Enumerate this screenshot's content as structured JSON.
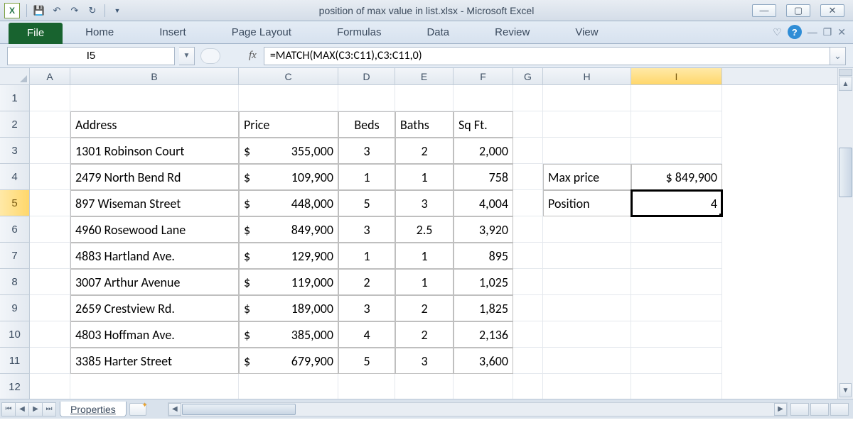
{
  "window": {
    "title": "position of max value in list.xlsx  -  Microsoft Excel"
  },
  "qat": {
    "save": "save",
    "undo": "undo",
    "redo": "redo",
    "repeat": "repeat"
  },
  "ribbon": {
    "file": "File",
    "tabs": [
      "Home",
      "Insert",
      "Page Layout",
      "Formulas",
      "Data",
      "Review",
      "View"
    ]
  },
  "formula_bar": {
    "namebox": "I5",
    "fx": "fx",
    "formula": "=MATCH(MAX(C3:C11),C3:C11,0)"
  },
  "columns": [
    "A",
    "B",
    "C",
    "D",
    "E",
    "F",
    "G",
    "H",
    "I"
  ],
  "rows": [
    "1",
    "2",
    "3",
    "4",
    "5",
    "6",
    "7",
    "8",
    "9",
    "10",
    "11",
    "12"
  ],
  "active": {
    "col": "I",
    "row": "5"
  },
  "table": {
    "headers": {
      "address": "Address",
      "price": "Price",
      "beds": "Beds",
      "baths": "Baths",
      "sqft": "Sq Ft."
    },
    "rows": [
      {
        "address": "1301 Robinson Court",
        "price": "355,000",
        "beds": "3",
        "baths": "2",
        "sqft": "2,000"
      },
      {
        "address": "2479 North Bend Rd",
        "price": "109,900",
        "beds": "1",
        "baths": "1",
        "sqft": "758"
      },
      {
        "address": "897 Wiseman Street",
        "price": "448,000",
        "beds": "5",
        "baths": "3",
        "sqft": "4,004"
      },
      {
        "address": "4960 Rosewood Lane",
        "price": "849,900",
        "beds": "3",
        "baths": "2.5",
        "sqft": "3,920"
      },
      {
        "address": "4883 Hartland Ave.",
        "price": "129,900",
        "beds": "1",
        "baths": "1",
        "sqft": "895"
      },
      {
        "address": "3007 Arthur Avenue",
        "price": "119,000",
        "beds": "2",
        "baths": "1",
        "sqft": "1,025"
      },
      {
        "address": "2659 Crestview Rd.",
        "price": "189,000",
        "beds": "3",
        "baths": "2",
        "sqft": "1,825"
      },
      {
        "address": "4803 Hoffman Ave.",
        "price": "385,000",
        "beds": "4",
        "baths": "2",
        "sqft": "2,136"
      },
      {
        "address": "3385 Harter Street",
        "price": "679,900",
        "beds": "5",
        "baths": "3",
        "sqft": "3,600"
      }
    ],
    "currency": "$"
  },
  "side": {
    "maxprice_label": "Max price",
    "maxprice_value": "$ 849,900",
    "position_label": "Position",
    "position_value": "4"
  },
  "sheet": {
    "name": "Properties"
  }
}
